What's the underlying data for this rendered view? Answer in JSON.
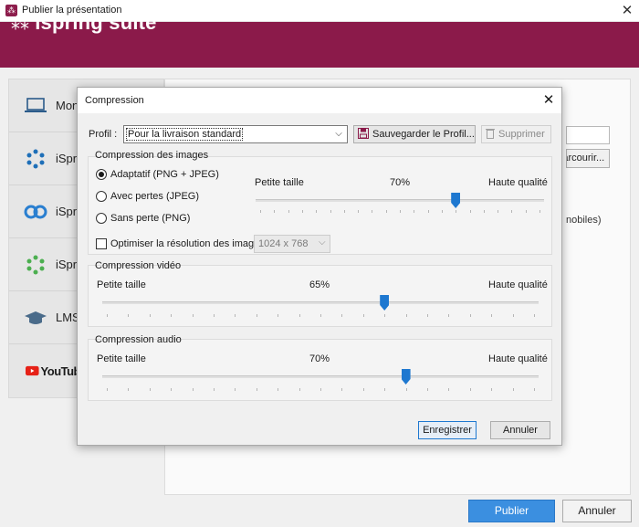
{
  "window": {
    "title": "Publier la présentation",
    "close_glyph": "✕"
  },
  "brand": {
    "name": "ispring suite"
  },
  "left_panel": {
    "items": [
      {
        "label": "Mon",
        "icon": "laptop-icon"
      },
      {
        "label": "iSpr",
        "icon": "ispring-cloud-icon"
      },
      {
        "label": "iSpr",
        "icon": "ispring-space-icon"
      },
      {
        "label": "iSpr",
        "icon": "ispring-learn-icon"
      },
      {
        "label": "LMS",
        "icon": "graduation-cap-icon"
      },
      {
        "label": "YouTub",
        "icon": "youtube-logo-icon"
      }
    ]
  },
  "background": {
    "browse_label": "Parcourir...",
    "mobiles_text": "nobiles)"
  },
  "footer": {
    "publish_label": "Publier",
    "cancel_label": "Annuler"
  },
  "dialog": {
    "title": "Compression",
    "close_glyph": "✕",
    "profile": {
      "label": "Profil :",
      "value": "Pour la livraison standard",
      "save_label": "Sauvegarder le Profil...",
      "delete_label": "Supprimer"
    },
    "images": {
      "title": "Compression des images",
      "options": [
        {
          "label": "Adaptatif (PNG + JPEG)",
          "checked": true
        },
        {
          "label": "Avec pertes (JPEG)",
          "checked": false
        },
        {
          "label": "Sans perte (PNG)",
          "checked": false
        }
      ],
      "slider": {
        "min_label": "Petite taille",
        "value_label": "70%",
        "max_label": "Haute qualité",
        "value": 70
      },
      "optimize": {
        "label": "Optimiser la résolution des images :",
        "checked": false,
        "resolution": "1024 x 768"
      }
    },
    "video": {
      "title": "Compression vidéo",
      "slider": {
        "min_label": "Petite taille",
        "value_label": "65%",
        "max_label": "Haute qualité",
        "value": 65
      }
    },
    "audio": {
      "title": "Compression audio",
      "slider": {
        "min_label": "Petite taille",
        "value_label": "70%",
        "max_label": "Haute qualité",
        "value": 70
      }
    },
    "save_label": "Enregistrer",
    "cancel_label": "Annuler"
  },
  "colors": {
    "brand": "#8b1a4a",
    "accent": "#1e78d0",
    "publish": "#3b8fe0"
  }
}
